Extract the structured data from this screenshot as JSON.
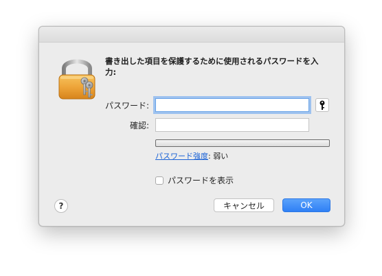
{
  "dialog": {
    "heading": "書き出した項目を保護するために使用されるパスワードを入力:",
    "password_label": "パスワード:",
    "password_value": "",
    "confirm_label": "確認:",
    "confirm_value": "",
    "strength_link": "パスワード強度",
    "strength_separator": ":",
    "strength_value": "弱い",
    "show_password_label": "パスワードを表示",
    "show_password_checked": false,
    "help_label": "?",
    "cancel_label": "キャンセル",
    "ok_label": "OK",
    "icons": {
      "lock": "lock-with-keys-icon",
      "key": "key-icon"
    },
    "colors": {
      "accent": "#2f80f5",
      "link": "#1a62d6",
      "focus_ring": "#9ec2ef"
    }
  }
}
